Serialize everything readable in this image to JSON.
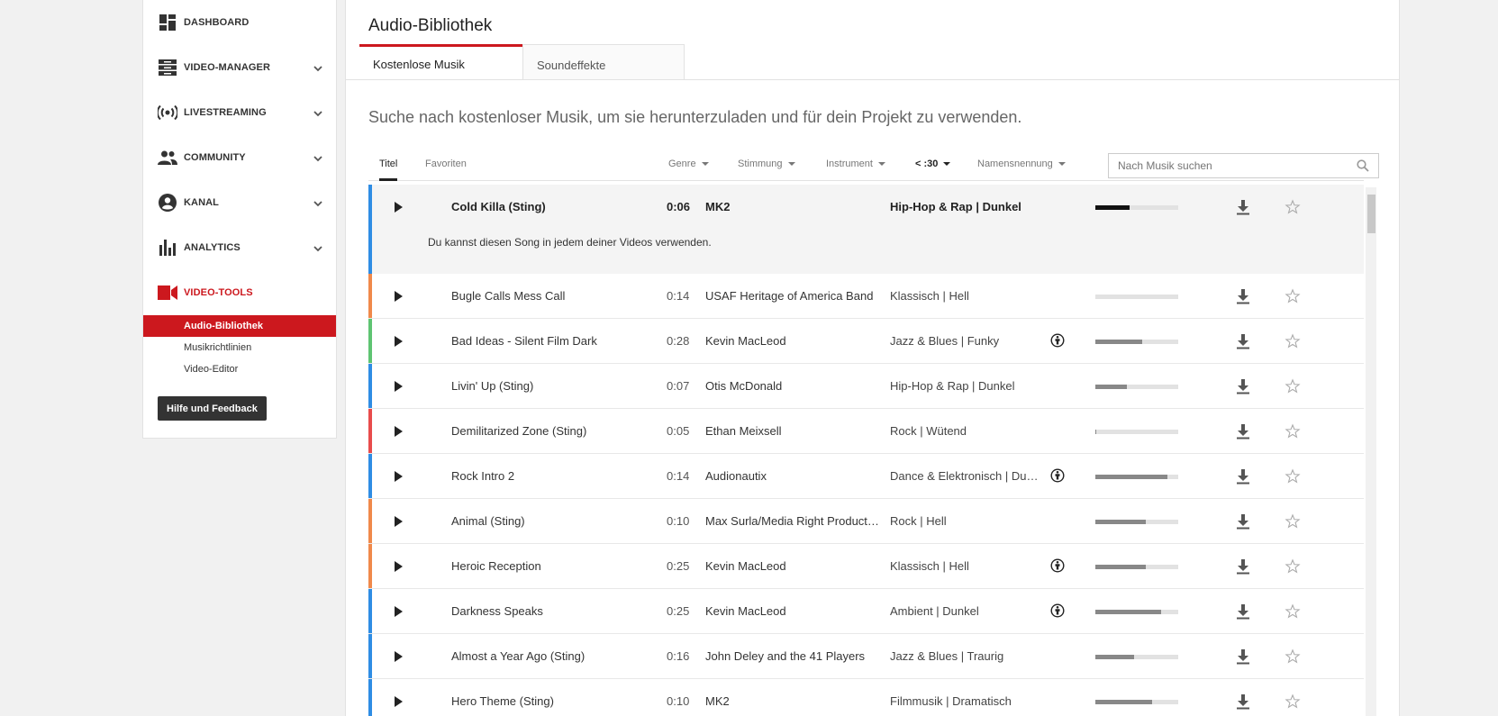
{
  "sidebar": {
    "items": [
      {
        "label": "DASHBOARD",
        "icon": "dashboard-icon",
        "chevron": false
      },
      {
        "label": "VIDEO-MANAGER",
        "icon": "video-manager-icon",
        "chevron": true
      },
      {
        "label": "LIVESTREAMING",
        "icon": "livestream-icon",
        "chevron": true
      },
      {
        "label": "COMMUNITY",
        "icon": "community-icon",
        "chevron": true
      },
      {
        "label": "KANAL",
        "icon": "channel-icon",
        "chevron": true
      },
      {
        "label": "ANALYTICS",
        "icon": "analytics-icon",
        "chevron": true
      },
      {
        "label": "VIDEO-TOOLS",
        "icon": "video-tools-icon",
        "chevron": false,
        "active": true
      }
    ],
    "sub_items": [
      {
        "label": "Audio-Bibliothek",
        "selected": true
      },
      {
        "label": "Musikrichtlinien",
        "selected": false
      },
      {
        "label": "Video-Editor",
        "selected": false
      }
    ],
    "help_button": "Hilfe und Feedback"
  },
  "main": {
    "title": "Audio-Bibliothek",
    "tabs": [
      {
        "label": "Kostenlose Musik",
        "active": true
      },
      {
        "label": "Soundeffekte",
        "active": false
      }
    ],
    "headline": "Suche nach kostenloser Musik, um sie herunterzuladen und für dein Projekt zu verwenden.",
    "filter_tabs": [
      {
        "label": "Titel",
        "active": true
      },
      {
        "label": "Favoriten",
        "active": false
      }
    ],
    "filters": {
      "genre": "Genre",
      "mood": "Stimmung",
      "instrument": "Instrument",
      "duration": "< :30",
      "attribution": "Namensnennung"
    },
    "search": {
      "placeholder": "Nach Musik suchen",
      "value": ""
    },
    "expanded_text": "Du kannst diesen Song in jedem deiner Videos verwenden.",
    "tracks": [
      {
        "title": "Cold Killa (Sting)",
        "duration": "0:06",
        "artist": "MK2",
        "genre": "Hip-Hop & Rap | Dunkel",
        "attribution": false,
        "popularity": 0.41,
        "color": "#2f8de4",
        "expanded": true
      },
      {
        "title": "Bugle Calls Mess Call",
        "duration": "0:14",
        "artist": "USAF Heritage of America Band",
        "genre": "Klassisch | Hell",
        "attribution": false,
        "popularity": 0.0,
        "color": "#f0894b"
      },
      {
        "title": "Bad Ideas - Silent Film Dark",
        "duration": "0:28",
        "artist": "Kevin MacLeod",
        "genre": "Jazz & Blues | Funky",
        "attribution": true,
        "popularity": 0.57,
        "color": "#5ec472"
      },
      {
        "title": "Livin' Up (Sting)",
        "duration": "0:07",
        "artist": "Otis McDonald",
        "genre": "Hip-Hop & Rap | Dunkel",
        "attribution": false,
        "popularity": 0.38,
        "color": "#2f8de4"
      },
      {
        "title": "Demilitarized Zone (Sting)",
        "duration": "0:05",
        "artist": "Ethan Meixsell",
        "genre": "Rock | Wütend",
        "attribution": false,
        "popularity": 0.01,
        "color": "#e84c4c"
      },
      {
        "title": "Rock Intro 2",
        "duration": "0:14",
        "artist": "Audionautix",
        "genre": "Dance & Elektronisch | Dunkel",
        "attribution": true,
        "popularity": 0.87,
        "color": "#2f8de4"
      },
      {
        "title": "Animal (Sting)",
        "duration": "0:10",
        "artist": "Max Surla/Media Right Productions",
        "genre": "Rock | Hell",
        "attribution": false,
        "popularity": 0.61,
        "color": "#f0894b"
      },
      {
        "title": "Heroic Reception",
        "duration": "0:25",
        "artist": "Kevin MacLeod",
        "genre": "Klassisch | Hell",
        "attribution": true,
        "popularity": 0.61,
        "color": "#f0894b"
      },
      {
        "title": "Darkness Speaks",
        "duration": "0:25",
        "artist": "Kevin MacLeod",
        "genre": "Ambient | Dunkel",
        "attribution": true,
        "popularity": 0.79,
        "color": "#2f8de4"
      },
      {
        "title": "Almost a Year Ago (Sting)",
        "duration": "0:16",
        "artist": "John Deley and the 41 Players",
        "genre": "Jazz & Blues | Traurig",
        "attribution": false,
        "popularity": 0.47,
        "color": "#2f8de4"
      },
      {
        "title": "Hero Theme (Sting)",
        "duration": "0:10",
        "artist": "MK2",
        "genre": "Filmmusik | Dramatisch",
        "attribution": false,
        "popularity": 0.69,
        "color": "#2f8de4"
      }
    ]
  },
  "colors": {
    "accent": "#cc181e"
  }
}
